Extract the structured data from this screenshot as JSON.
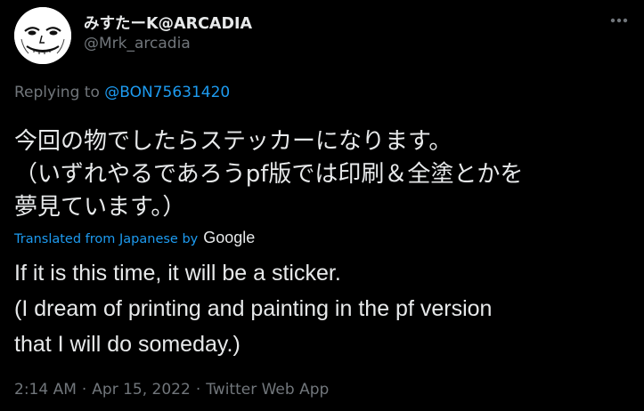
{
  "author": {
    "display_name": "みすたーK@ARCADIA",
    "handle": "@Mrk_arcadia"
  },
  "reply": {
    "prefix": "Replying to",
    "mention": "@BON75631420"
  },
  "tweet": {
    "original_text": "今回の物でしたらステッカーになります。\n（いずれやるであろうpf版では印刷＆全塗とかを\n夢見ています。）",
    "translated_label": "Translated from Japanese by",
    "translator": "Google",
    "translation_text": "If it is this time, it will be a sticker.\n (I dream of printing and painting in the pf version\nthat I will do someday.)"
  },
  "meta": {
    "time": "2:14 AM",
    "separator": "·",
    "date": "Apr 15, 2022",
    "source": "Twitter Web App"
  },
  "colors": {
    "background": "#000000",
    "text_primary": "#e7e9ea",
    "text_secondary": "#71767b",
    "accent": "#1d9bf0"
  },
  "icons": {
    "more": "more-horizontal-icon"
  }
}
